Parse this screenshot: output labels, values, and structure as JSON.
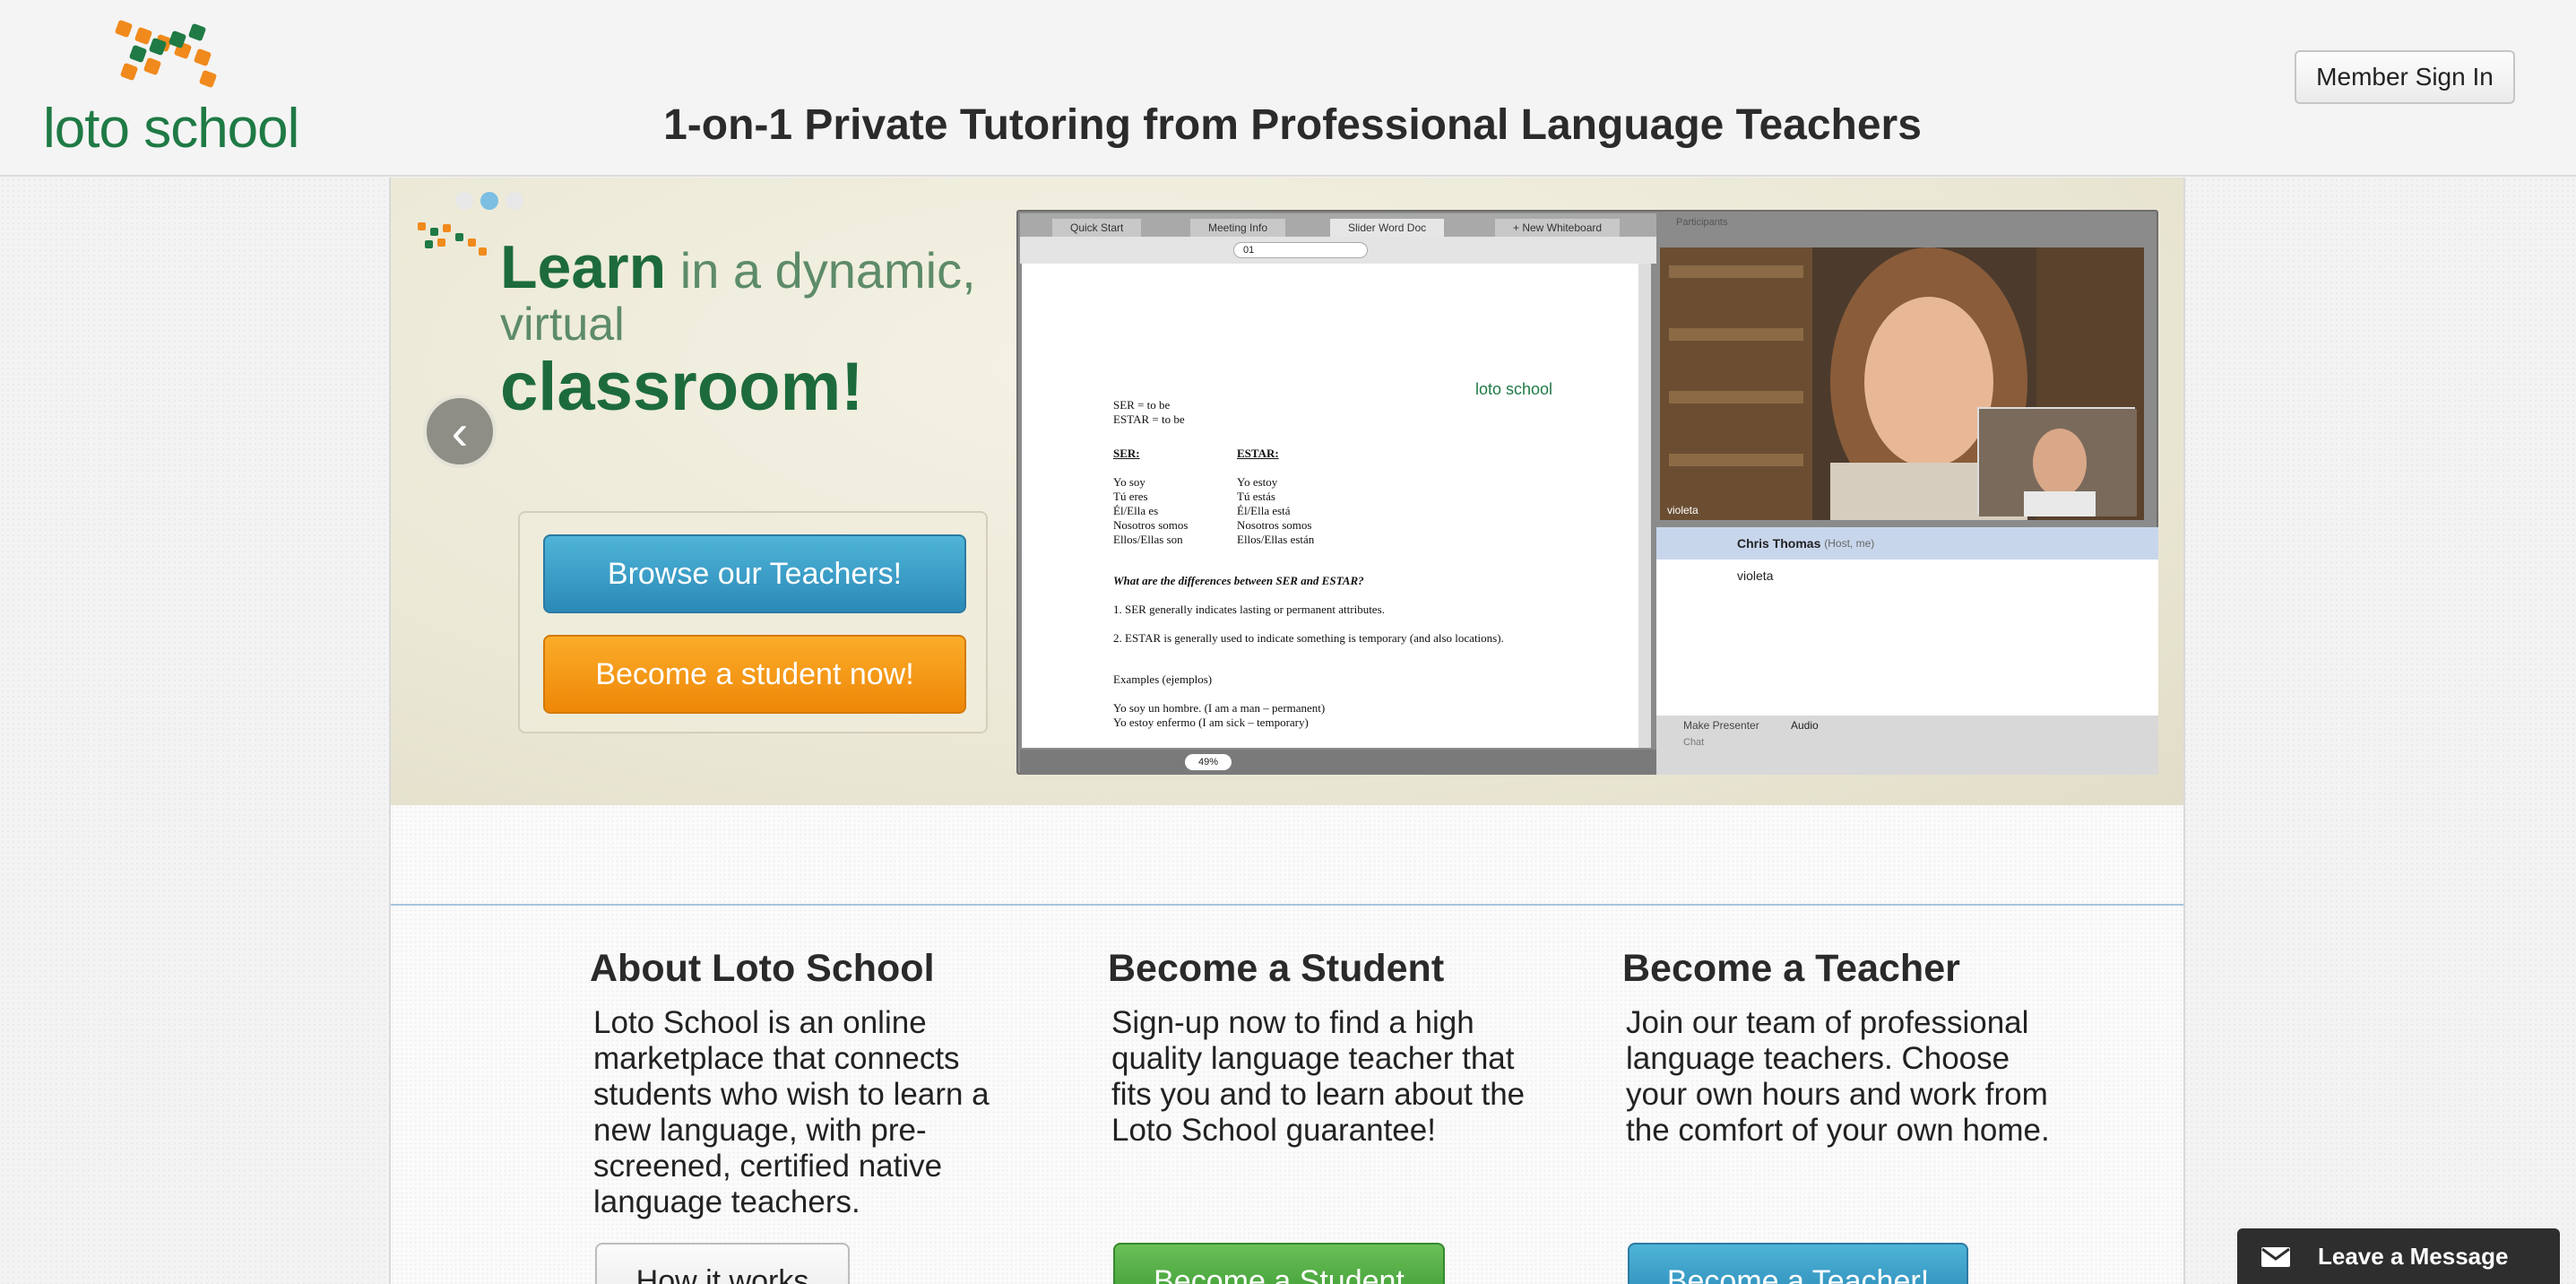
{
  "header": {
    "logo_text": "loto school",
    "tagline": "1-on-1 Private Tutoring from Professional Language Teachers",
    "signin_label": "Member Sign In"
  },
  "banner": {
    "headline_learn": "Learn",
    "headline_rest": " in a dynamic,",
    "headline_virtual": "virtual",
    "headline_classroom": "classroom!",
    "browse_label": "Browse our Teachers!",
    "become_label": "Become a student now!",
    "prev_glyph": "‹",
    "next_glyph": "›",
    "slide_count": 3,
    "active_slide": 2,
    "screenshot": {
      "tabs": [
        "Quick Start",
        "Meeting Info",
        "Slider Word Doc",
        "+ New Whiteboard"
      ],
      "participants_header": "Participants",
      "zoom": "49%",
      "page_field": "01",
      "doc_logo": "loto school",
      "doc_lines": {
        "l1": "SER = to be",
        "l2": "ESTAR = to be",
        "ser_head": "SER:",
        "estar_head": "ESTAR:",
        "ser1": "Yo soy",
        "ser2": "Tú eres",
        "ser3": "Él/Ella es",
        "ser4": "Nosotros somos",
        "ser5": "Ellos/Ellas son",
        "estar1": "Yo estoy",
        "estar2": "Tú estás",
        "estar3": "Él/Ella está",
        "estar4": "Nosotros somos",
        "estar5": "Ellos/Ellas están",
        "q": "What are the differences between SER and ESTAR?",
        "n1": "1.  SER generally indicates lasting or permanent attributes.",
        "n2": "2.  ESTAR is generally used to indicate something is temporary (and also locations).",
        "ex": "Examples (ejemplos)",
        "ex1": "Yo soy un hombre. (I am a man – permanent)",
        "ex2": "Yo estoy enfermo (I am sick – temporary)"
      },
      "video_label": "violeta",
      "host_name": "Chris Thomas",
      "host_note": "(Host, me)",
      "participant2": "violeta",
      "make_presenter": "Make Presenter",
      "audio": "Audio",
      "chat": "Chat"
    }
  },
  "columns": [
    {
      "title": "About Loto School",
      "body": "Loto School is an online marketplace that connects students who wish to learn a new language, with pre-screened, certified native language teachers.",
      "button": "How it works"
    },
    {
      "title": "Become a Student",
      "body": "Sign-up now to find a high quality language teacher that fits you and to learn about the Loto School guarantee!",
      "button": "Become a Student"
    },
    {
      "title": "Become a Teacher",
      "body": "Join our team of professional language teachers. Choose your own hours and work from the comfort of your own home.",
      "button": "Become a Teacher!"
    }
  ],
  "chat_widget": {
    "label": "Leave a Message",
    "icon": "envelope-icon"
  },
  "colors": {
    "brand_green": "#1f7a45",
    "brand_orange": "#f08a1c",
    "blue_button": "#2b8ab7",
    "orange_button": "#ee8707",
    "green_button": "#3c9b32"
  }
}
